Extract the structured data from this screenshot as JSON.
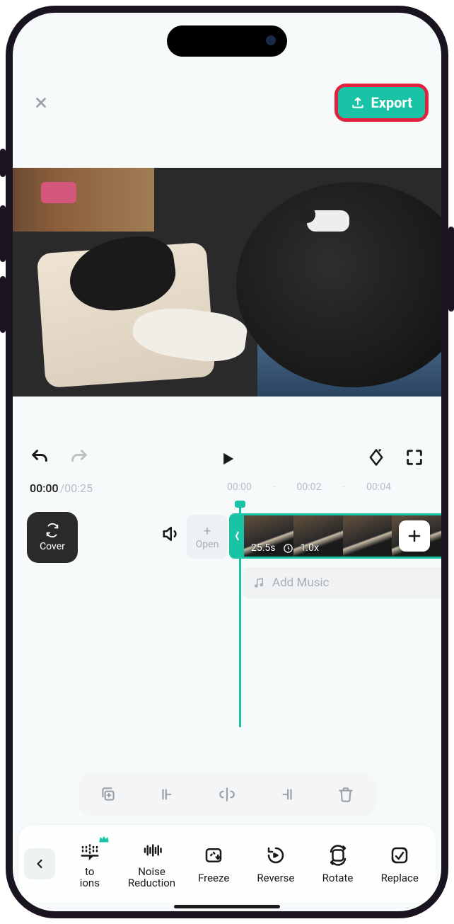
{
  "header": {
    "export_label": "Export"
  },
  "time": {
    "current": "00:00",
    "total": "/00:25",
    "marks": [
      "00:00",
      "00:02",
      "00:04"
    ]
  },
  "timeline": {
    "cover_label": "Cover",
    "open_label": "Open",
    "clip_duration": "25.5s",
    "clip_speed": "1.0x",
    "add_music_label": "Add Music"
  },
  "bottom_tools": {
    "item0_line1": "to",
    "item0_line2": "ions",
    "item1_line1": "Noise",
    "item1_line2": "Reduction",
    "item2": "Freeze",
    "item3": "Reverse",
    "item4": "Rotate",
    "item5": "Replace"
  }
}
